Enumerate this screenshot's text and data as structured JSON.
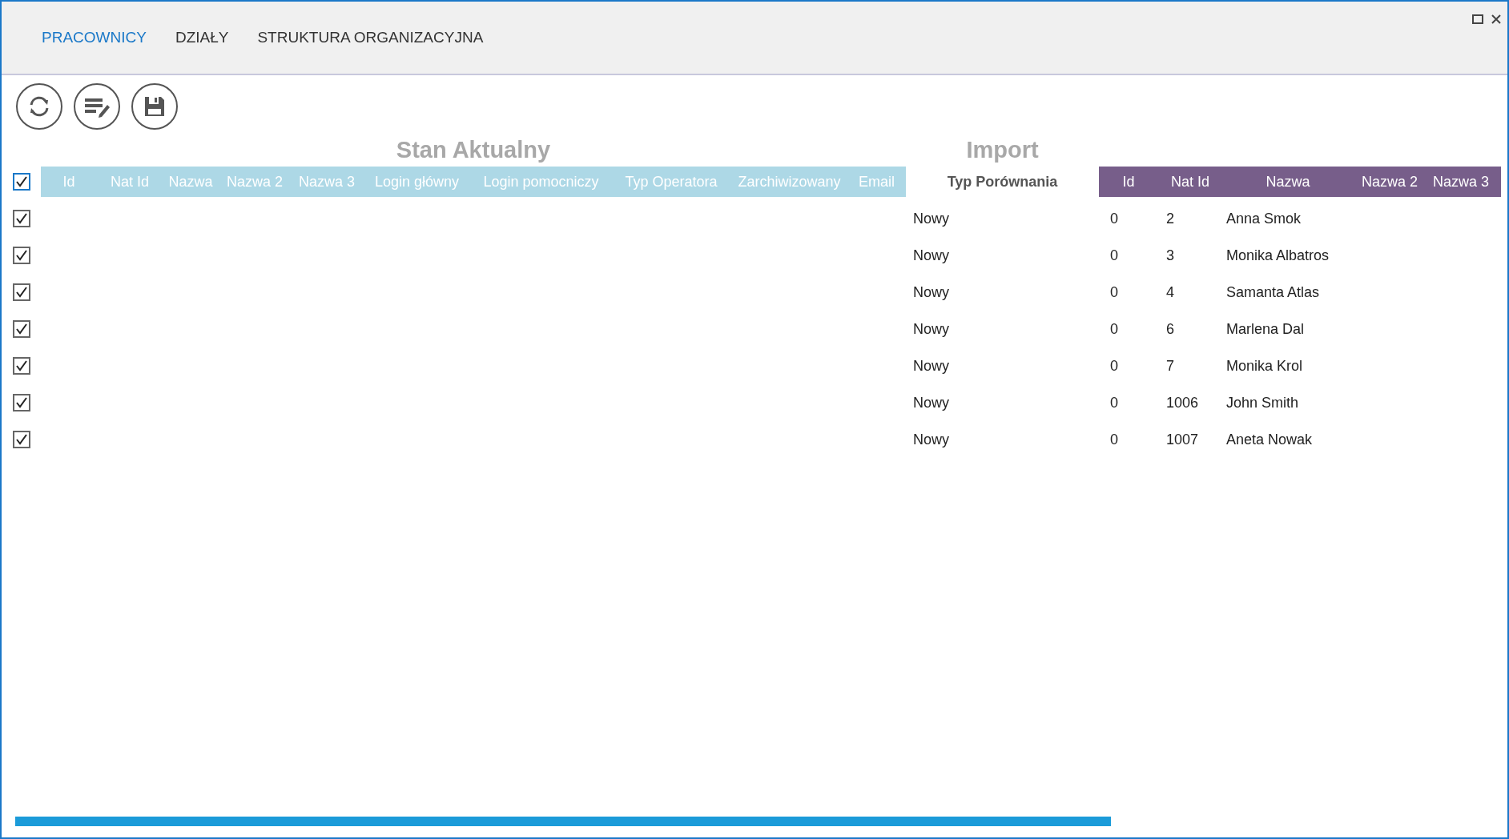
{
  "tabs": [
    {
      "label": "PRACOWNICY",
      "selected": true
    },
    {
      "label": "DZIAŁY",
      "selected": false
    },
    {
      "label": "STRUKTURA ORGANIZACYJNA",
      "selected": false
    }
  ],
  "current": {
    "title": "Stan Aktualny",
    "select_all_checked": true,
    "columns": [
      "Id",
      "Nat Id",
      "Nazwa",
      "Nazwa 2",
      "Nazwa 3",
      "Login główny",
      "Login pomocniczy",
      "Typ Operatora",
      "Zarchiwizowany",
      "Email"
    ]
  },
  "comparison": {
    "title": "Import",
    "column": "Typ Porównania"
  },
  "import": {
    "columns": [
      "Id",
      "Nat Id",
      "Nazwa",
      "Nazwa 2",
      "Nazwa 3"
    ]
  },
  "rows": [
    {
      "checked": true,
      "comparison": "Nowy",
      "id": "0",
      "nat_id": "2",
      "nazwa": "Anna Smok"
    },
    {
      "checked": true,
      "comparison": "Nowy",
      "id": "0",
      "nat_id": "3",
      "nazwa": "Monika Albatros"
    },
    {
      "checked": true,
      "comparison": "Nowy",
      "id": "0",
      "nat_id": "4",
      "nazwa": "Samanta Atlas"
    },
    {
      "checked": true,
      "comparison": "Nowy",
      "id": "0",
      "nat_id": "6",
      "nazwa": "Marlena Dal"
    },
    {
      "checked": true,
      "comparison": "Nowy",
      "id": "0",
      "nat_id": "7",
      "nazwa": "Monika Krol"
    },
    {
      "checked": true,
      "comparison": "Nowy",
      "id": "0",
      "nat_id": "1006",
      "nazwa": "John Smith"
    },
    {
      "checked": true,
      "comparison": "Nowy",
      "id": "0",
      "nat_id": "1007",
      "nazwa": "Aneta Nowak"
    }
  ]
}
